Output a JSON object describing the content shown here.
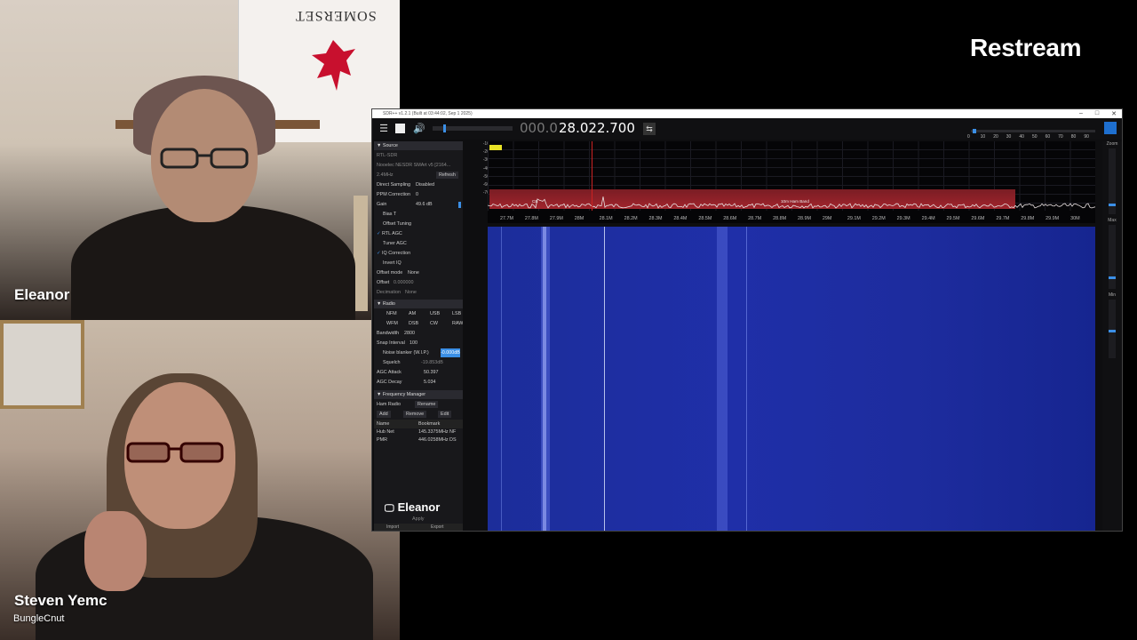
{
  "brand": "Restream",
  "participants": [
    {
      "name": "Eleanor",
      "sub": ""
    },
    {
      "name": "Steven Yemc",
      "sub": "BungleCnut"
    }
  ],
  "backdrop": {
    "flag_text": "SOMERSET"
  },
  "app": {
    "title": "SDR++ v1.2.1 (Built at 03:44:02, Sep 1 2025)",
    "freq_dim": "000.0",
    "freq_bright": "28.022.700",
    "scale_labels": [
      "0",
      "10",
      "20",
      "30",
      "40",
      "50",
      "60",
      "70",
      "80",
      "90"
    ],
    "accent": "#3b8fe6"
  },
  "sidebar": {
    "source_header": "Source",
    "source_device": "RTL-SDR",
    "device_name": "Nooelec NESDR SMArt v5 [2164...",
    "sample_rate": "2.4MHz",
    "refresh_label": "Refresh",
    "direct_sampling_label": "Direct Sampling",
    "direct_sampling_value": "Disabled",
    "ppm_label": "PPM Correction",
    "ppm_value": "0",
    "gain_label": "Gain",
    "gain_value": "49.6 dB",
    "bias_t": "Bias T",
    "offset_tuning": "Offset Tuning",
    "rtl_agc": "RTL AGC",
    "tuner_agc": "Tuner AGC",
    "iq_correction": "IQ Correction",
    "invert_iq": "Invert IQ",
    "offset_mode_label": "Offset mode",
    "offset_mode_value": "None",
    "offset_label": "Offset",
    "offset_value": "0.000000",
    "decimation_label": "Decimation",
    "decimation_value": "None",
    "radio_header": "Radio",
    "modes": [
      "NFM",
      "AM",
      "USB",
      "LSB",
      "WFM",
      "DSB",
      "CW",
      "RAW"
    ],
    "selected_mode": "USB",
    "bandwidth_label": "Bandwidth",
    "bandwidth_value": "2800",
    "snap_label": "Snap Interval",
    "snap_value": "100",
    "noise_blanker_label": "Noise blanker (W.I.P.)",
    "noise_blanker_value": "-0.000dB",
    "squelch_label": "Squelch",
    "squelch_value": "-19.853dB",
    "agc_attack_label": "AGC Attack",
    "agc_attack_value": "50.397",
    "agc_decay_label": "AGC Decay",
    "agc_decay_value": "5.034",
    "fm_header": "Frequency Manager",
    "fm_list": "Ham Radio",
    "rename_label": "Rename",
    "add_label": "Add",
    "remove_label": "Remove",
    "edit_label": "Edit",
    "col_name": "Name",
    "col_bookmark": "Bookmark",
    "bookmarks": [
      {
        "name": "Hub Net",
        "bookmark": "145.3375MHz NF"
      },
      {
        "name": "PMR",
        "bookmark": "446.0258MHz DS"
      }
    ],
    "apply_label": "Apply",
    "import_label": "Import",
    "export_label": "Export",
    "screen_share_name": "Eleanor"
  },
  "spectrum": {
    "ylabels": [
      "-10",
      "-20",
      "-30",
      "-40",
      "-50",
      "-60",
      "-70"
    ],
    "xlabels": [
      "27.7M",
      "27.8M",
      "27.9M",
      "28M",
      "28.1M",
      "28.2M",
      "28.3M",
      "28.4M",
      "28.5M",
      "28.6M",
      "28.7M",
      "28.8M",
      "28.9M",
      "29M",
      "29.1M",
      "29.2M",
      "29.3M",
      "29.4M",
      "29.5M",
      "29.6M",
      "29.7M",
      "29.8M",
      "29.9M",
      "30M"
    ],
    "band_labels": [
      "CB",
      "10m Ham Band"
    ]
  },
  "rail": {
    "zoom": "Zoom",
    "max": "Max",
    "min": "Min"
  }
}
